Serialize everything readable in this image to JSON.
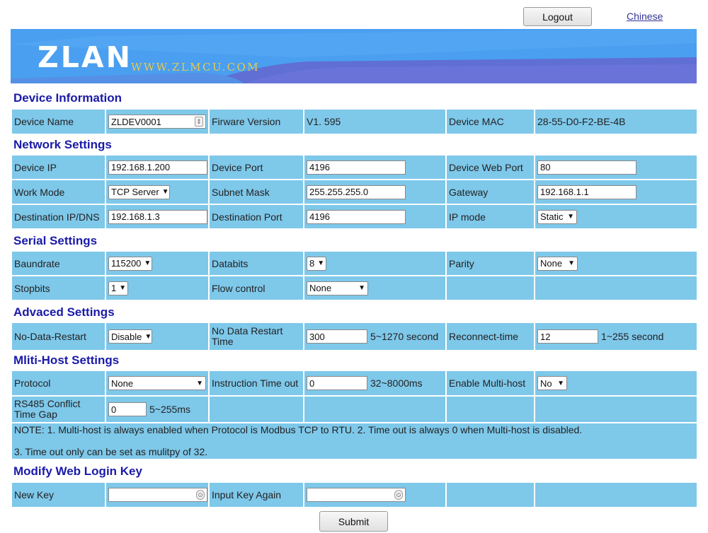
{
  "header": {
    "logout_label": "Logout",
    "language_link": "Chinese"
  },
  "banner": {
    "logo": "ZLAN",
    "website": "WWW.ZLMCU.COM",
    "colors": {
      "sky": "#4a9ff0",
      "wave": "#5f6fd4"
    }
  },
  "device_info": {
    "title": "Device Information",
    "name_label": "Device Name",
    "name_value": "ZLDEV0001",
    "fw_label": "Firware Version",
    "fw_value": "V1. 595",
    "mac_label": "Device MAC",
    "mac_value": "28-55-D0-F2-BE-4B"
  },
  "network": {
    "title": "Network Settings",
    "ip_label": "Device IP",
    "ip_value": "192.168.1.200",
    "port_label": "Device Port",
    "port_value": "4196",
    "webport_label": "Device Web Port",
    "webport_value": "80",
    "workmode_label": "Work Mode",
    "workmode_value": "TCP Server",
    "mask_label": "Subnet Mask",
    "mask_value": "255.255.255.0",
    "gateway_label": "Gateway",
    "gateway_value": "192.168.1.1",
    "destip_label": "Destination IP/DNS",
    "destip_value": "192.168.1.3",
    "destport_label": "Destination Port",
    "destport_value": "4196",
    "ipmode_label": "IP mode",
    "ipmode_value": "Static"
  },
  "serial": {
    "title": "Serial Settings",
    "baud_label": "Baundrate",
    "baud_value": "115200",
    "databits_label": "Databits",
    "databits_value": "8",
    "parity_label": "Parity",
    "parity_value": "None",
    "stopbits_label": "Stopbits",
    "stopbits_value": "1",
    "flow_label": "Flow control",
    "flow_value": "None"
  },
  "advanced": {
    "title": "Advaced Settings",
    "ndr_label": "No-Data-Restart",
    "ndr_value": "Disable",
    "ndrtime_label": "No Data Restart Time",
    "ndrtime_value": "300",
    "ndrtime_unit": "5~1270 second",
    "reconnect_label": "Reconnect-time",
    "reconnect_value": "12",
    "reconnect_unit": "1~255 second"
  },
  "multihost": {
    "title": "Mliti-Host Settings",
    "protocol_label": "Protocol",
    "protocol_value": "None",
    "timeout_label": "Instruction Time out",
    "timeout_value": "0",
    "timeout_unit": "32~8000ms",
    "enable_label": "Enable Multi-host",
    "enable_value": "No",
    "gap_label": "RS485 Conflict Time Gap",
    "gap_value": "0",
    "gap_unit": "5~255ms",
    "note_line1": "NOTE: 1. Multi-host is always enabled when Protocol is Modbus TCP to RTU. 2. Time out is always 0 when Multi-host is disabled.",
    "note_line2": "3. Time out only can be set as mulitpy of 32."
  },
  "login_key": {
    "title": "Modify Web Login Key",
    "new_label": "New Key",
    "new_value": "",
    "again_label": "Input Key Again",
    "again_value": ""
  },
  "submit_label": "Submit"
}
